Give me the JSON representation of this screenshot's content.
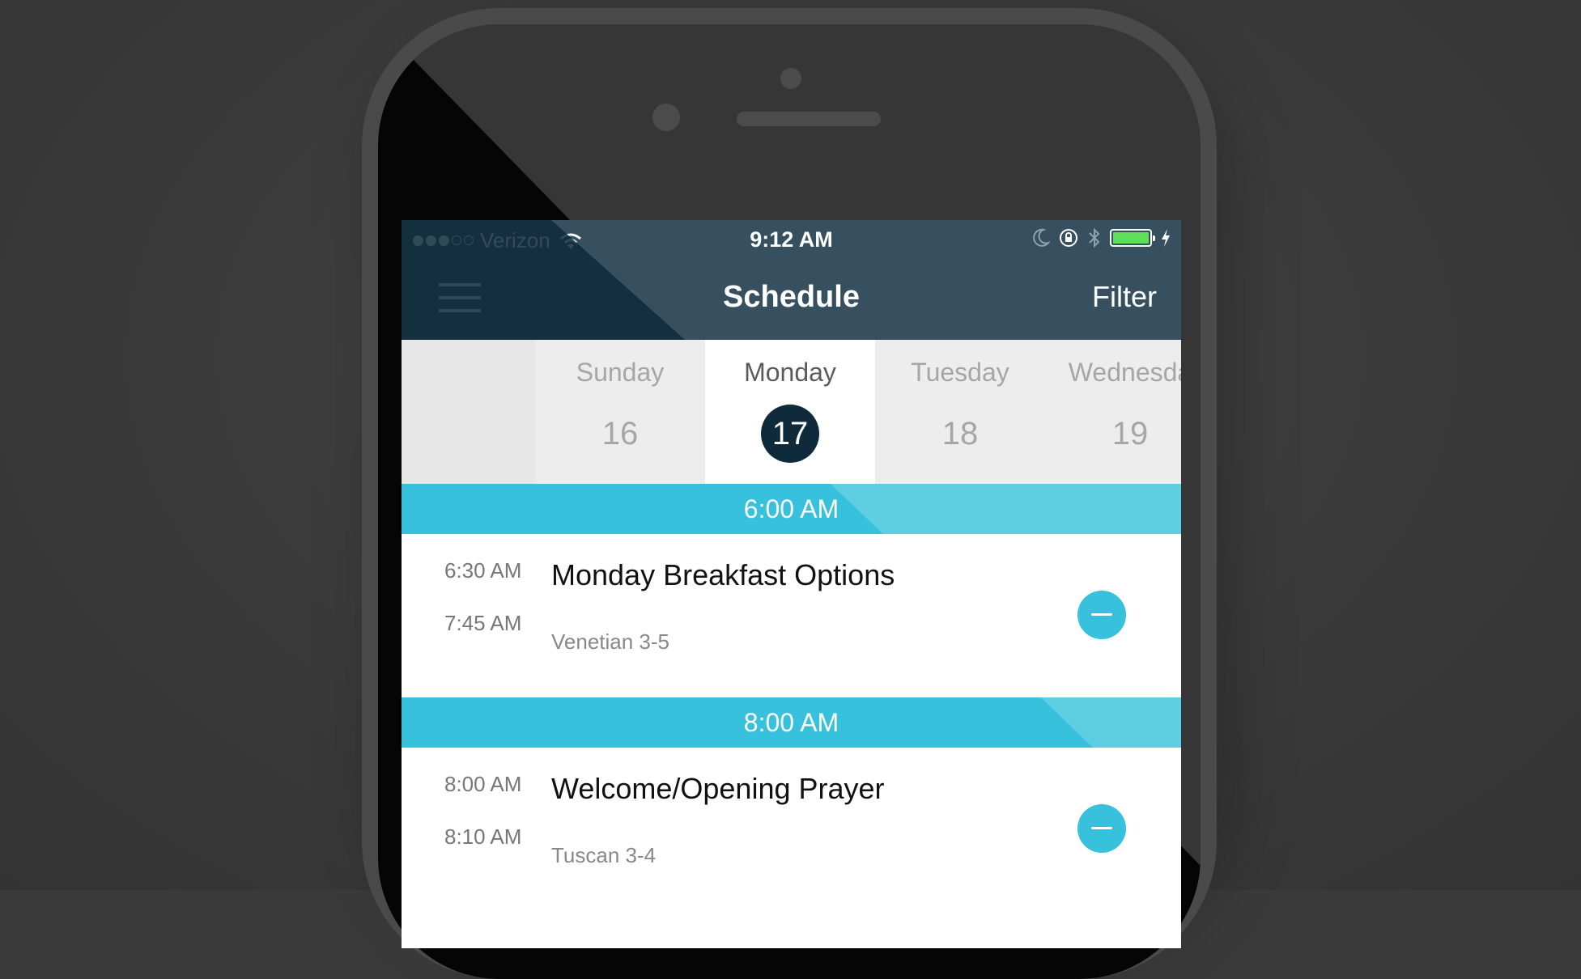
{
  "colors": {
    "nav_bg": "#36505f",
    "nav_dark": "#0e2a3b",
    "accent": "#38c1dc",
    "accent_light": "#5ecfe3",
    "battery": "#5fe05a"
  },
  "status_bar": {
    "carrier": "Verizon",
    "time": "9:12 AM",
    "signal_bars_filled": 3,
    "signal_bars_total": 5,
    "battery_level": 1.0,
    "icons": [
      "wifi-icon",
      "moon-icon",
      "rotation-lock-icon",
      "bluetooth-icon",
      "battery-icon",
      "charging-icon"
    ]
  },
  "navbar": {
    "menu_icon": "hamburger-menu-icon",
    "title": "Schedule",
    "filter_label": "Filter"
  },
  "days": [
    {
      "name": "Sunday",
      "number": "16",
      "selected": false
    },
    {
      "name": "Monday",
      "number": "17",
      "selected": true
    },
    {
      "name": "Tuesday",
      "number": "18",
      "selected": false
    },
    {
      "name": "Wednesda",
      "number": "19",
      "selected": false
    }
  ],
  "slots": [
    {
      "header": "6:00 AM",
      "event": {
        "start": "6:30 AM",
        "end": "7:45 AM",
        "title": "Monday Breakfast Options",
        "room": "Venetian 3-5",
        "action_icon": "minus-icon"
      }
    },
    {
      "header": "8:00 AM",
      "event": {
        "start": "8:00 AM",
        "end": "8:10 AM",
        "title": "Welcome/Opening Prayer",
        "room": "Tuscan 3-4",
        "action_icon": "minus-icon"
      }
    }
  ]
}
